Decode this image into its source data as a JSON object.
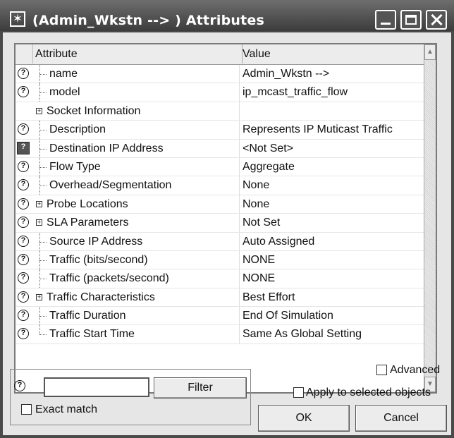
{
  "window": {
    "title": "(Admin_Wkstn --> ) Attributes"
  },
  "grid": {
    "header": {
      "attribute": "Attribute",
      "value": "Value"
    },
    "rows": [
      {
        "attr": "name",
        "value": "Admin_Wkstn -->",
        "expandable": false,
        "selected": false
      },
      {
        "attr": "model",
        "value": "ip_mcast_traffic_flow",
        "expandable": false,
        "selected": false
      },
      {
        "attr": "Socket Information",
        "value": "",
        "expandable": true,
        "selected": false
      },
      {
        "attr": "Description",
        "value": "Represents IP Muticast Traffic",
        "expandable": false,
        "selected": false
      },
      {
        "attr": "Destination IP Address",
        "value": "<Not Set>",
        "expandable": false,
        "selected": true
      },
      {
        "attr": "Flow Type",
        "value": "Aggregate",
        "expandable": false,
        "selected": false
      },
      {
        "attr": "Overhead/Segmentation",
        "value": "None",
        "expandable": false,
        "selected": false
      },
      {
        "attr": "Probe Locations",
        "value": "None",
        "expandable": true,
        "selected": false
      },
      {
        "attr": "SLA Parameters",
        "value": "Not Set",
        "expandable": true,
        "selected": false
      },
      {
        "attr": "Source IP Address",
        "value": "Auto Assigned",
        "expandable": false,
        "selected": false
      },
      {
        "attr": "Traffic (bits/second)",
        "value": "NONE",
        "expandable": false,
        "selected": false
      },
      {
        "attr": "Traffic (packets/second)",
        "value": "NONE",
        "expandable": false,
        "selected": false
      },
      {
        "attr": "Traffic Characteristics",
        "value": "Best Effort",
        "expandable": true,
        "selected": false
      },
      {
        "attr": "Traffic Duration",
        "value": "End Of Simulation",
        "expandable": false,
        "selected": false
      },
      {
        "attr": "Traffic Start Time",
        "value": "Same As Global Setting",
        "expandable": false,
        "selected": false
      }
    ]
  },
  "footer": {
    "filter_label": "Filter",
    "filter_value": "",
    "exact_match_label": "Exact match",
    "exact_match_checked": false,
    "advanced_label": "Advanced",
    "advanced_checked": false,
    "apply_label": "Apply to selected objects",
    "apply_checked": false,
    "ok_label": "OK",
    "cancel_label": "Cancel"
  },
  "icons": {
    "help": "help-icon",
    "expand": "expand-plus-icon",
    "system": "system-menu-icon"
  }
}
